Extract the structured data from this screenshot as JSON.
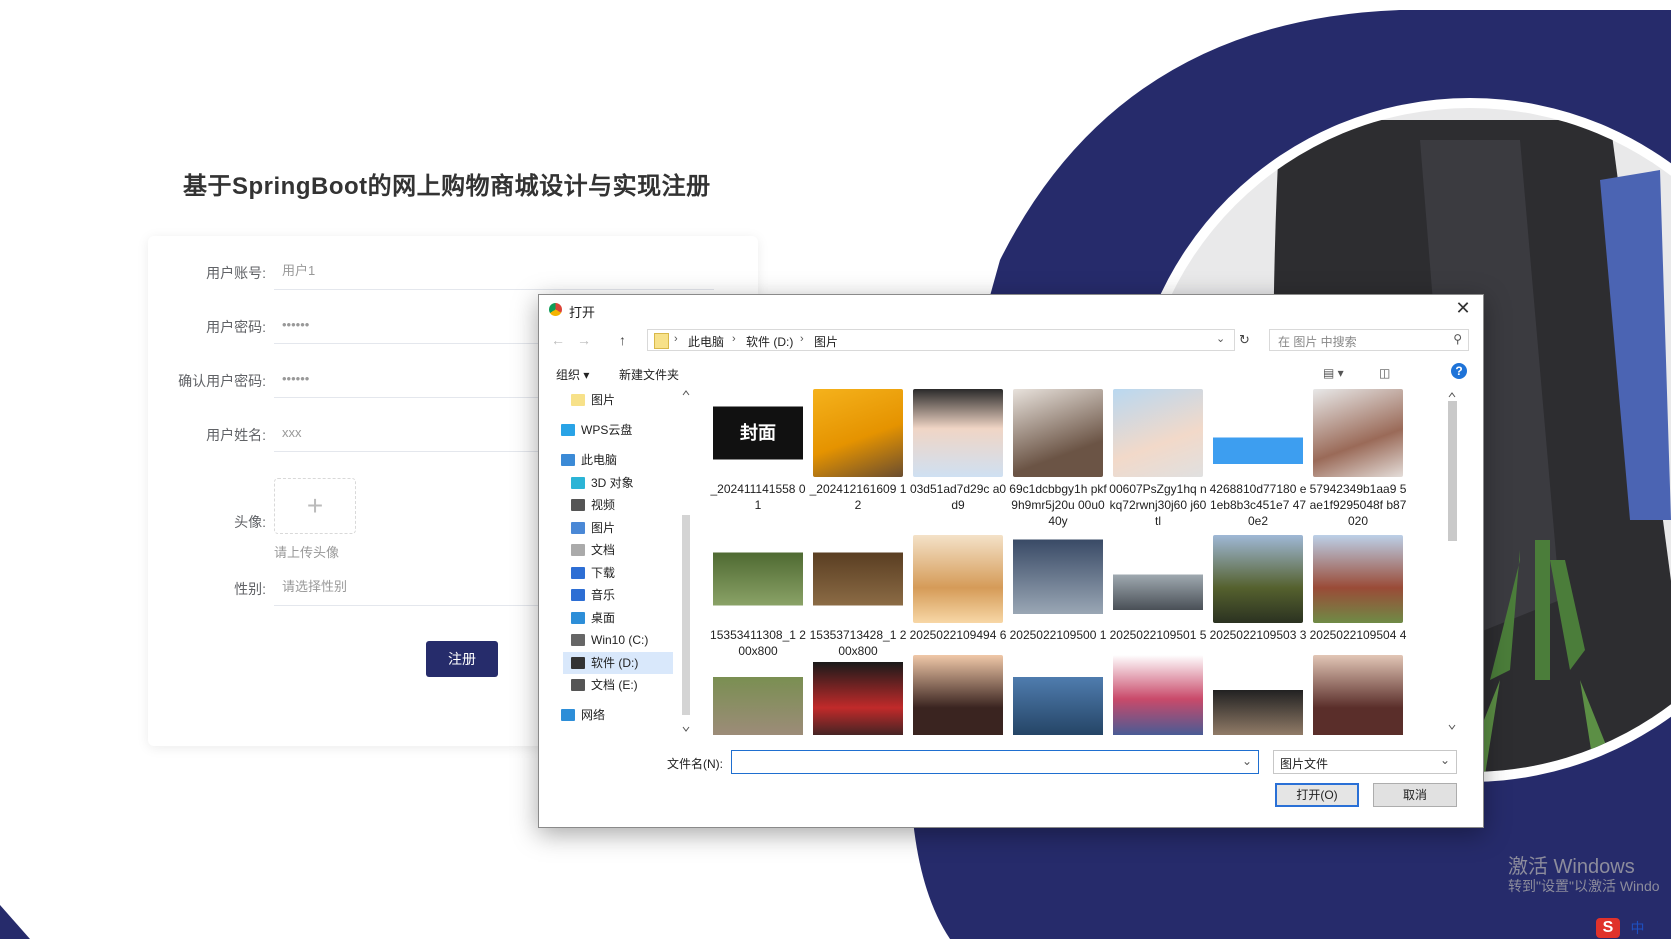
{
  "page": {
    "title": "基于SpringBoot的网上购物商城设计与实现注册",
    "colors": {
      "accent": "#262c6b",
      "band": "#262b6b"
    }
  },
  "form": {
    "account_label": "用户账号:",
    "account_value": "用户1",
    "password_label": "用户密码:",
    "password_value": "••••••",
    "confirm_label": "确认用户密码:",
    "confirm_value": "••••••",
    "name_label": "用户姓名:",
    "name_value": "xxx",
    "avatar_label": "头像:",
    "avatar_hint": "请上传头像",
    "gender_label": "性别:",
    "gender_placeholder": "请选择性别",
    "submit_label": "注册"
  },
  "dialog": {
    "title": "打开",
    "breadcrumbs": [
      "此电脑",
      "软件 (D:)",
      "图片"
    ],
    "search_placeholder": "在 图片 中搜索",
    "toolbar": {
      "organize": "组织 ▾",
      "new_folder": "新建文件夹"
    },
    "tree": [
      {
        "label": "图片",
        "icon": "folder-icon"
      },
      {
        "label": "WPS云盘",
        "icon": "cloud-icon"
      },
      {
        "label": "此电脑",
        "icon": "computer-icon"
      },
      {
        "label": "3D 对象",
        "icon": "cube-icon"
      },
      {
        "label": "视频",
        "icon": "video-icon"
      },
      {
        "label": "图片",
        "icon": "pictures-icon"
      },
      {
        "label": "文档",
        "icon": "document-icon"
      },
      {
        "label": "下载",
        "icon": "download-icon"
      },
      {
        "label": "音乐",
        "icon": "music-icon"
      },
      {
        "label": "桌面",
        "icon": "desktop-icon"
      },
      {
        "label": "Win10 (C:)",
        "icon": "drive-icon"
      },
      {
        "label": "软件 (D:)",
        "icon": "drive-icon",
        "selected": true
      },
      {
        "label": "文档 (E:)",
        "icon": "drive-icon"
      },
      {
        "label": "网络",
        "icon": "network-icon"
      }
    ],
    "files": [
      {
        "name": "_202411141558 01",
        "thumb_text": "封面"
      },
      {
        "name": "_202412161609 12"
      },
      {
        "name": "03d51ad7d29c a0d9"
      },
      {
        "name": "69c1dcbbgy1h pkf9h9mr5j20u 00u040y"
      },
      {
        "name": "00607PsZgy1hq nkq72rwnj30j60 j60tl"
      },
      {
        "name": "4268810d77180 e1eb8b3c451e7 470e2"
      },
      {
        "name": "57942349b1aa9 5ae1f9295048f b87020"
      },
      {
        "name": "15353411308_1 200x800"
      },
      {
        "name": "15353713428_1 200x800"
      },
      {
        "name": "2025022109494 6"
      },
      {
        "name": "2025022109500 1"
      },
      {
        "name": "2025022109501 5"
      },
      {
        "name": "2025022109503 3"
      },
      {
        "name": "2025022109504 4"
      },
      {
        "name": ""
      },
      {
        "name": ""
      },
      {
        "name": ""
      },
      {
        "name": ""
      },
      {
        "name": ""
      },
      {
        "name": ""
      },
      {
        "name": ""
      }
    ],
    "filename_label": "文件名(N):",
    "filename_value": "",
    "filetype_value": "图片文件",
    "open_label": "打开(O)",
    "cancel_label": "取消"
  },
  "watermark": {
    "line1": "激活 Windows",
    "line2": "转到\"设置\"以激活 Windo"
  },
  "ime": {
    "label": "中"
  }
}
